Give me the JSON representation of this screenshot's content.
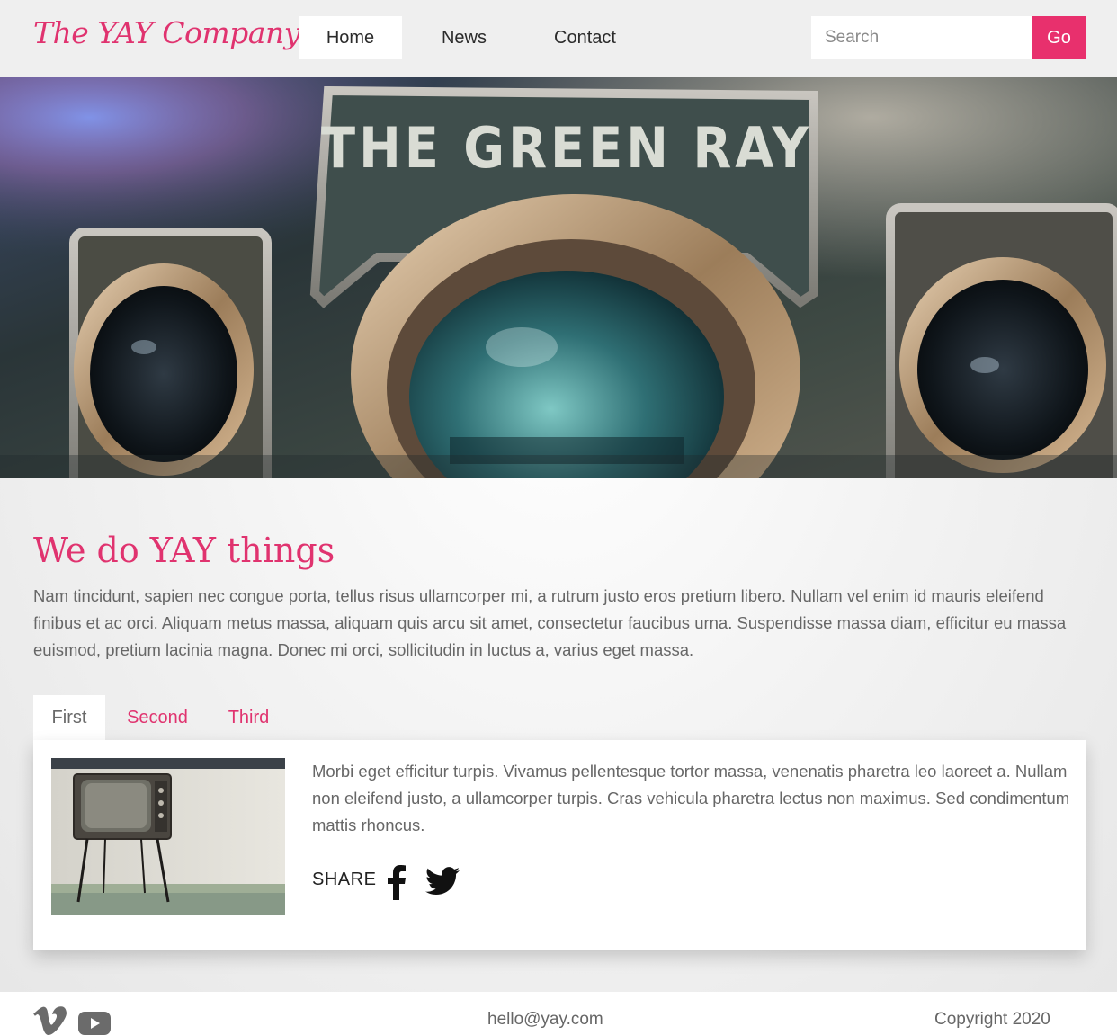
{
  "header": {
    "logo": "The YAY Company",
    "nav": [
      {
        "label": "Home",
        "active": true
      },
      {
        "label": "News",
        "active": false
      },
      {
        "label": "Contact",
        "active": false
      }
    ],
    "search": {
      "placeholder": "Search",
      "value": ""
    },
    "go_label": "Go"
  },
  "hero": {
    "sign_text": "THE GREEN RAY"
  },
  "intro": {
    "heading": "We do YAY things",
    "text": "Nam tincidunt, sapien nec congue porta, tellus risus ullamcorper mi, a rutrum justo eros pretium libero. Nullam vel enim id mauris eleifend finibus et ac orci. Aliquam metus massa, aliquam quis arcu sit amet, consectetur faucibus urna. Suspendisse massa diam, efficitur eu massa euismod, pretium lacinia magna. Donec mi orci, sollicitudin in luctus a, varius eget massa."
  },
  "tabs": [
    {
      "label": "First",
      "active": true
    },
    {
      "label": "Second",
      "active": false
    },
    {
      "label": "Third",
      "active": false
    }
  ],
  "panel": {
    "text": "Morbi eget efficitur turpis. Vivamus pellentesque tortor massa, venenatis pharetra leo laoreet a. Nullam non eleifend justo, a ullamcorper turpis. Cras vehicula pharetra lectus non maximus. Sed condimentum mattis rhoncus.",
    "share_label": "SHARE",
    "share_icons": [
      "facebook-icon",
      "twitter-icon"
    ]
  },
  "footer": {
    "social_icons": [
      "vimeo-icon",
      "youtube-icon"
    ],
    "email": "hello@yay.com",
    "copyright": "Copyright 2020"
  },
  "colors": {
    "accent": "#e8306d",
    "header_bg": "#efefef",
    "text": "#676767"
  }
}
